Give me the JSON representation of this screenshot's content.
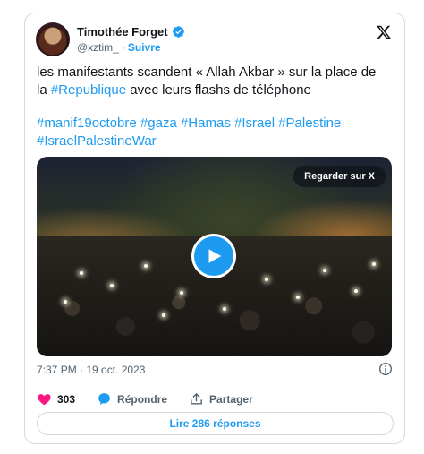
{
  "author": {
    "display_name": "Timothée Forget",
    "handle": "@xztim_",
    "separator": "·",
    "follow_label": "Suivre"
  },
  "tweet": {
    "line1": "les manifestants scandent « Allah Akbar » sur la place de",
    "line2_prefix": "la ",
    "line2_tag": "#Republique",
    "line2_suffix": " avec leurs flashs de téléphone",
    "hashtags_row1": [
      "#manif19octobre",
      "#gaza",
      "#Hamas",
      "#Israel",
      "#Palestine"
    ],
    "hashtags_row2": [
      "#IsraelPalestineWar"
    ]
  },
  "media": {
    "watch_label": "Regarder sur X",
    "icon": "play-icon"
  },
  "meta": {
    "timestamp": "7:37 PM · 19 oct. 2023"
  },
  "actions": {
    "like_count": "303",
    "reply_label": "Répondre",
    "share_label": "Partager"
  },
  "replies_button": "Lire 286 réponses",
  "colors": {
    "accent": "#1d9bf0",
    "like": "#f91880",
    "secondary_text": "#536471",
    "border": "#cfd9de"
  }
}
